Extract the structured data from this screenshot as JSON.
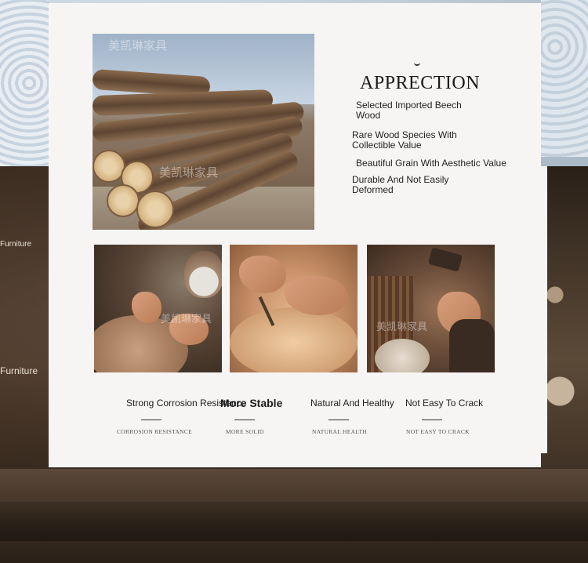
{
  "background": {
    "side_text_1": "Furniture",
    "side_text_2": "Furniture"
  },
  "hero_photo": {
    "watermark_1": "美凯琳家具",
    "watermark_2": "美凯琳家具"
  },
  "headline": "APPRECTION",
  "features": [
    "Selected Imported Beech\nWood",
    "Rare Wood Species With\nCollectible Value",
    "Beautiful Grain With Aesthetic Value",
    "Durable And Not Easily\nDeformed"
  ],
  "craft_photos": {
    "watermark_1": "美凯琳家具",
    "watermark_2": "美凯琳家具"
  },
  "labels": [
    {
      "title": "Strong Corrosion Resistance",
      "subtitle": "CORROSION RESISTANCE"
    },
    {
      "title": "More Stable",
      "subtitle": "MORE SOLID"
    },
    {
      "title": "Natural And Healthy",
      "subtitle": "NATURAL HEALTH"
    },
    {
      "title": "Not Easy To Crack",
      "subtitle": "NOT EASY TO CRACK"
    }
  ]
}
